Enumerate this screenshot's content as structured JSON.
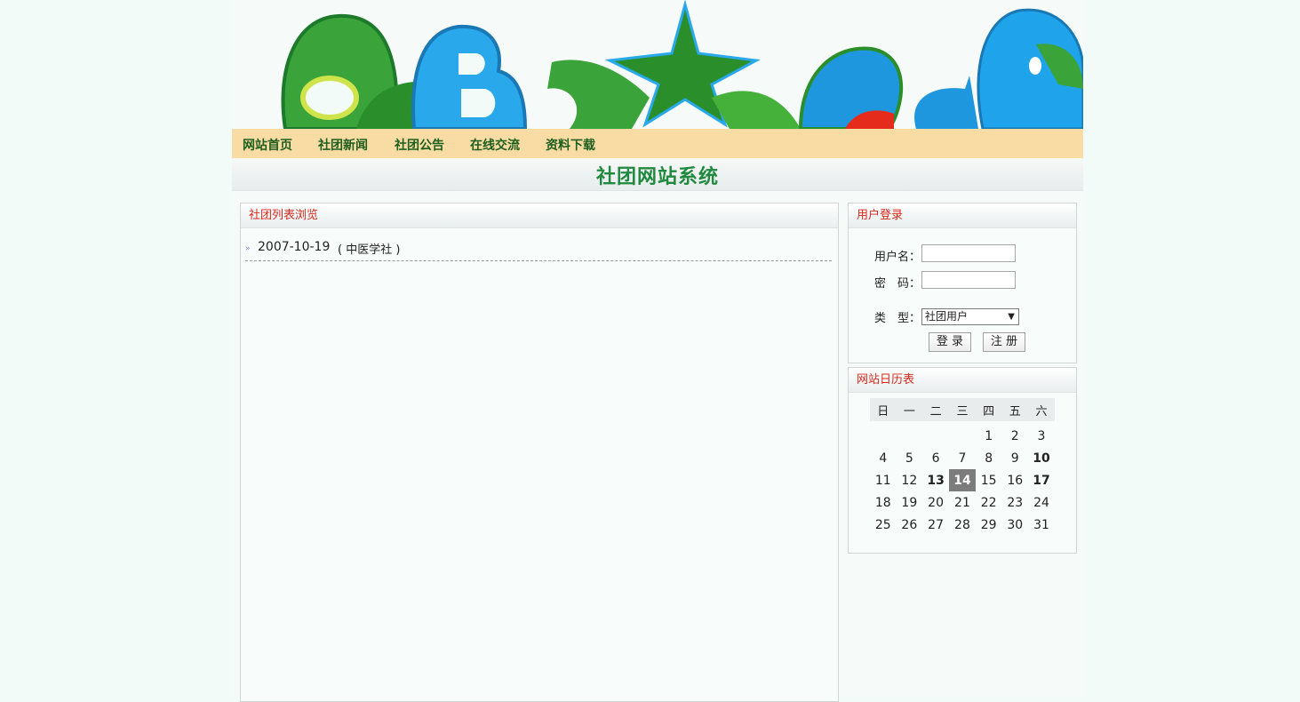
{
  "nav": {
    "items": [
      "网站首页",
      "社团新闻",
      "社团公告",
      "在线交流",
      "资料下载"
    ]
  },
  "site_title": "社团网站系统",
  "main_panel": {
    "title": "社团列表浏览",
    "items": [
      {
        "date": "2007-10-19",
        "club": "( 中医学社 )"
      }
    ]
  },
  "login": {
    "title": "用户登录",
    "username_label": "用户名：",
    "password_label": "密　码：",
    "type_label": "类　型：",
    "username_value": "",
    "password_value": "",
    "type_selected": "社团用户",
    "login_button": "登 录",
    "register_button": "注 册"
  },
  "calendar": {
    "title": "网站日历表",
    "weekdays": [
      "日",
      "一",
      "二",
      "三",
      "四",
      "五",
      "六"
    ],
    "weeks": [
      [
        "",
        "",
        "",
        "",
        "1",
        "2",
        "3"
      ],
      [
        "4",
        "5",
        "6",
        "7",
        "8",
        "9",
        "10"
      ],
      [
        "11",
        "12",
        "13",
        "14",
        "15",
        "16",
        "17"
      ],
      [
        "18",
        "19",
        "20",
        "21",
        "22",
        "23",
        "24"
      ],
      [
        "25",
        "26",
        "27",
        "28",
        "29",
        "30",
        "31"
      ]
    ],
    "today": "14",
    "bold_days": [
      "10",
      "13",
      "14",
      "17"
    ]
  },
  "colors": {
    "nav_bg": "#f8dca4",
    "nav_text": "#1e5e1e",
    "title_green": "#1f8a3f",
    "panel_head_red": "#d8281b"
  }
}
